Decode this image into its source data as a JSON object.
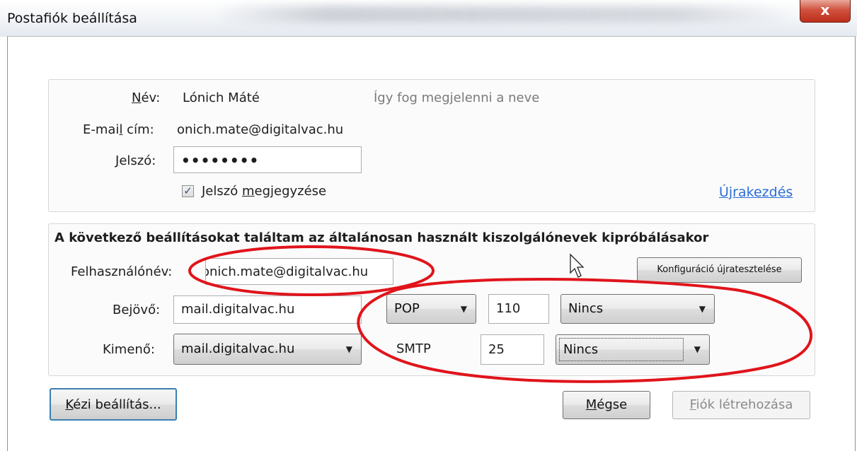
{
  "window": {
    "title": "Postafiók beállítása",
    "close_glyph": "x"
  },
  "account": {
    "name_label": "Név:",
    "name_value": "Lónich Máté",
    "name_hint": "Így fog megjelenni a neve",
    "email_label": "E-mail cím:",
    "email_value": "onich.mate@digitalvac.hu",
    "password_label": "Jelszó:",
    "password_value": "••••••••",
    "remember_label": "Jelszó megjegyzése",
    "remember_checked": true,
    "restart_link": "Újrakezdés"
  },
  "server": {
    "heading": "A következő beállításokat találtam az általánosan használt kiszolgálónevek kipróbálásakor",
    "username_label": "Felhasználónév:",
    "username_value": "onich.mate@digitalvac.hu",
    "retest_button": "Konfiguráció újratesztelése",
    "incoming_label": "Bejövő:",
    "incoming_host": "mail.digitalvac.hu",
    "incoming_protocol": "POP",
    "incoming_port": "110",
    "incoming_security": "Nincs",
    "outgoing_label": "Kimenő:",
    "outgoing_host": "mail.digitalvac.hu",
    "outgoing_protocol": "SMTP",
    "outgoing_port": "25",
    "outgoing_security": "Nincs"
  },
  "buttons": {
    "manual": "Kézi beállítás...",
    "cancel": "Mégse",
    "create": "Fiók létrehozása"
  },
  "colors": {
    "annotation": "#e0141b",
    "link": "#2a6ed6",
    "close": "#c9412d"
  },
  "icons": {
    "dropdown": "chevron-down-icon",
    "pointer": "mouse-cursor-icon",
    "check": "checkmark-icon"
  }
}
